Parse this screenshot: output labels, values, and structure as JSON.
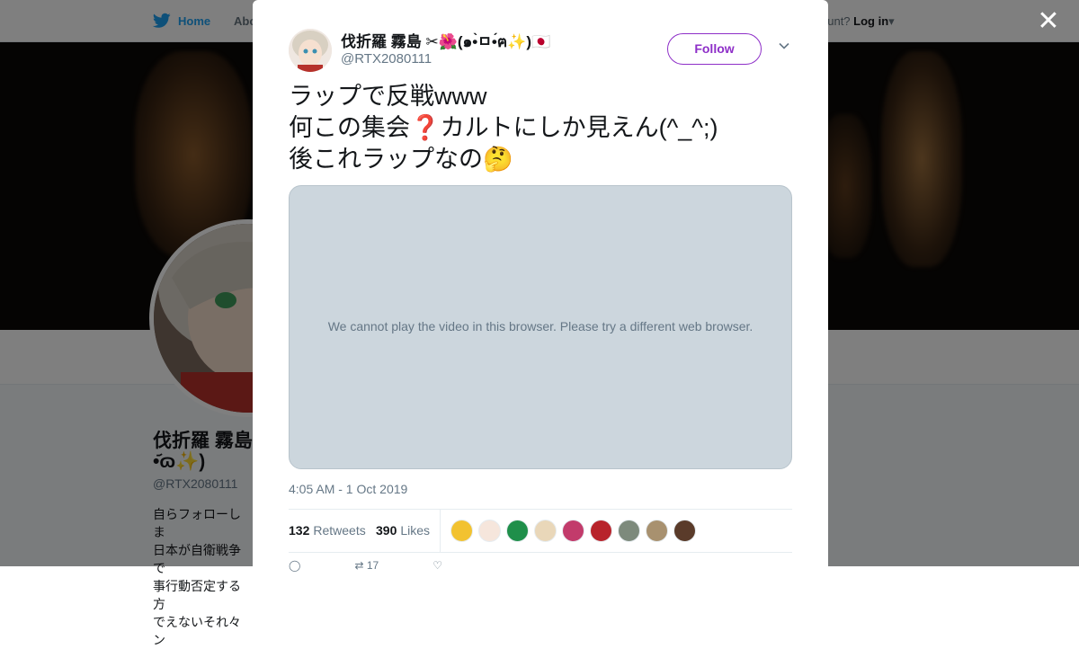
{
  "background": {
    "nav": {
      "home_label": "Home",
      "about_label": "Abo",
      "account_question": "ccount?",
      "login_label": "Log in"
    },
    "profile": {
      "name_line1": "伐折羅 霧島",
      "name_line2": "•᷄ɷ✨)",
      "handle": "@RTX2080111",
      "bio_lines": [
        "自らフォローしま",
        "日本が自衛戦争で",
        "事行動否定する方",
        "でえないそれ々ン"
      ]
    }
  },
  "close_icon_glyph": "✕",
  "tweet": {
    "author_name": "伐折羅 霧島 ✂🌺(๑•̀ㅁ•́ฅ✨)🇯🇵",
    "author_handle": "@RTX2080111",
    "follow_label": "Follow",
    "text_lines": [
      "ラップで反戦www",
      "何この集会❓カルトにしか見えん(^_^;)",
      "後これラップなの🤔"
    ],
    "video_message": "We cannot play the video in this browser. Please try a different web browser.",
    "timestamp": "4:05 AM - 1 Oct 2019",
    "retweets_count": "132",
    "retweets_label": "Retweets",
    "likes_count": "390",
    "likes_label": "Likes",
    "liker_avatar_colors": [
      "#f2c230",
      "#f6e6dc",
      "#1f8f4a",
      "#e9d7b9",
      "#c23b6b",
      "#b8232b",
      "#7d8a7c",
      "#a8916f",
      "#5a3b2a"
    ],
    "action_counts": {
      "reply": "",
      "retweet": "17",
      "like": ""
    }
  },
  "colors": {
    "follow_accent": "#8e2fc8",
    "twitter_blue": "#1da1f2"
  }
}
